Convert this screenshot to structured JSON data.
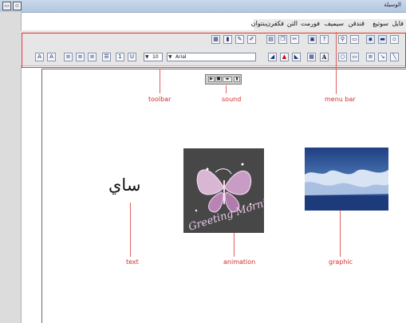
{
  "window": {
    "title": "الوسيلة",
    "controls": [
      "minimize",
      "restore"
    ]
  },
  "menu_bar": {
    "items": [
      "فايل",
      "سوتيغ",
      "قندقن",
      "سيميف",
      "فورمت",
      "التن",
      "فكقرن",
      "بنتوان"
    ]
  },
  "toolbar": {
    "font_name": "Arial",
    "font_size": "10",
    "bold_label": "A"
  },
  "annotations": {
    "toolbar": "toolbar",
    "sound": "sound",
    "menu_bar": "menu bar",
    "text": "text",
    "animation": "animation",
    "graphic": "graphic"
  },
  "canvas": {
    "text_content": "ساي",
    "animation_caption": "Greeting Morning"
  },
  "colors": {
    "annotation_red": "#d42b2b",
    "titlebar": "#c9d8ec",
    "toolbar_bg": "#e6e6e6"
  }
}
